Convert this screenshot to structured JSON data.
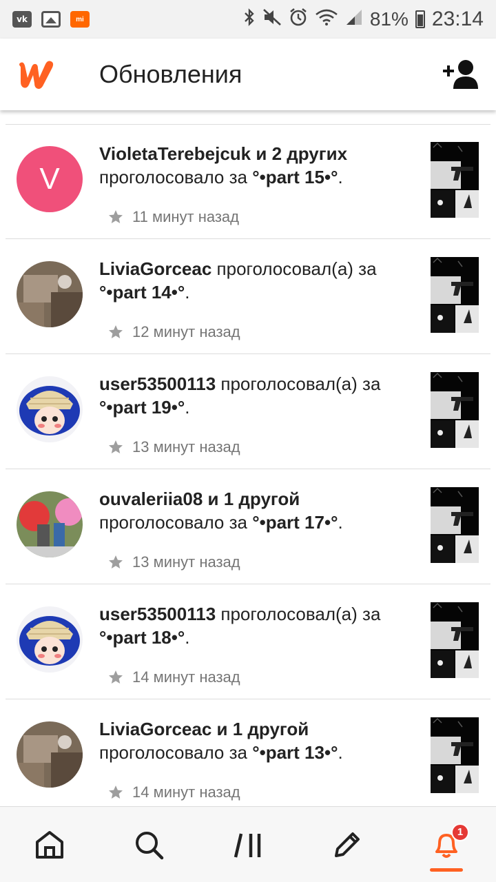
{
  "status_bar": {
    "left_icons": [
      "vk-icon",
      "gallery-icon",
      "mi-icon"
    ],
    "right_icons": [
      "bluetooth-icon",
      "mute-icon",
      "alarm-icon",
      "wifi-icon",
      "signal-icon"
    ],
    "battery": "81%",
    "time": "23:14"
  },
  "app_bar": {
    "title": "Обновления",
    "brand_color": "#ff6122"
  },
  "feed": [
    {
      "user": "VioletaTerebejcuk",
      "user_suffix": " и 2 других",
      "user_bold_all": true,
      "action": "проголосовало за ",
      "story": "°•part 15•°",
      "time": "11 минут назад",
      "avatar_letter": "V"
    },
    {
      "user": "LiviaGorceac",
      "user_suffix": "",
      "user_bold_all": false,
      "action": " проголосовал(а) за ",
      "story": "°•part 14•°",
      "time": "12 минут назад"
    },
    {
      "user": "user53500113",
      "user_suffix": "",
      "user_bold_all": false,
      "action": " проголосовал(а) за ",
      "story": "°•part 19•°",
      "time": "13 минут назад"
    },
    {
      "user": "ouvaleriia08",
      "user_suffix": " и 1 другой",
      "user_bold_all": true,
      "action": "проголосовало за ",
      "story": "°•part 17•°",
      "time": "13 минут назад"
    },
    {
      "user": "user53500113",
      "user_suffix": "",
      "user_bold_all": false,
      "action": " проголосовал(а) за ",
      "story": "°•part 18•°",
      "time": "14 минут назад"
    },
    {
      "user": "LiviaGorceac",
      "user_suffix": " и 1 другой",
      "user_bold_all": true,
      "action": "проголосовало за ",
      "story": "°•part 13•°",
      "time": "14 минут назад"
    }
  ],
  "bottom_nav": {
    "items": [
      "home-icon",
      "search-icon",
      "library-icon",
      "write-icon",
      "notifications-icon"
    ],
    "active": "notifications",
    "badge_count": "1"
  }
}
